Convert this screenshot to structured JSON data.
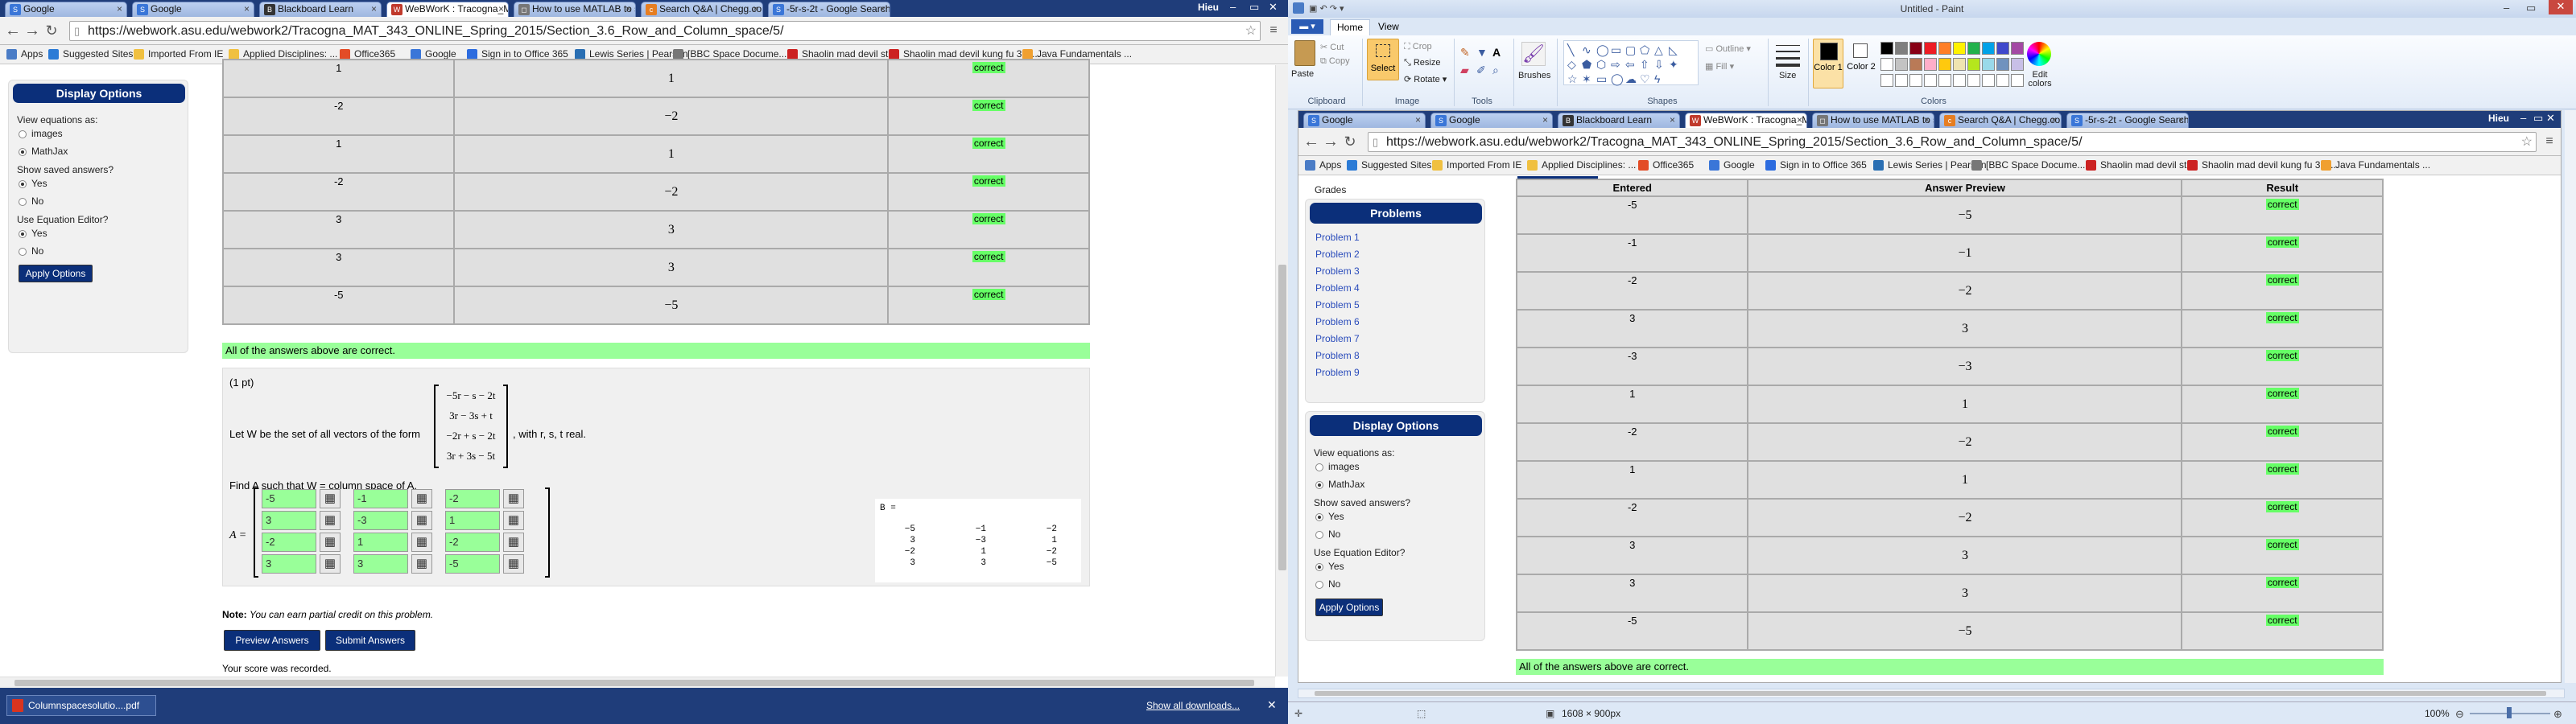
{
  "left": {
    "tabs": [
      {
        "label": "Google",
        "color": "#3a76d8",
        "glyph": "S"
      },
      {
        "label": "Google",
        "color": "#3a76d8",
        "glyph": "S"
      },
      {
        "label": "Blackboard Learn",
        "color": "#333333",
        "glyph": "B"
      },
      {
        "label": "WeBWorK : Tracogna_MA",
        "color": "#c0392b",
        "glyph": "W"
      },
      {
        "label": "How to use MATLAB to s",
        "color": "#777777",
        "glyph": "◻"
      },
      {
        "label": "Search Q&A | Chegg.com",
        "color": "#e67e22",
        "glyph": "c"
      },
      {
        "label": "-5r-s-2t - Google Search",
        "color": "#3a76d8",
        "glyph": "S"
      }
    ],
    "user": "Hieu",
    "url": "https://webwork.asu.edu/webwork2/Tracogna_MAT_343_ONLINE_Spring_2015/Section_3.6_Row_and_Column_space/5/",
    "bookmarks": [
      "Apps",
      "Suggested Sites",
      "Imported From IE",
      "Applied Disciplines: ...",
      "Office365",
      "Google",
      "Sign in to Office 365",
      "Lewis Series | Pearson",
      "[BBC Space Docume...",
      "Shaolin mad devil st...",
      "Shaolin mad devil kung fu 32 j...",
      "Java Fundamentals ..."
    ],
    "display_options": {
      "title": "Display Options",
      "view_label": "View equations as:",
      "view_options": [
        "images",
        "MathJax"
      ],
      "saved_label": "Show saved answers?",
      "saved_options": [
        "Yes",
        "No"
      ],
      "editor_label": "Use Equation Editor?",
      "editor_options": [
        "Yes",
        "No"
      ],
      "apply": "Apply Options"
    },
    "results_rows": [
      {
        "entered": "1",
        "preview": "1",
        "result": "correct"
      },
      {
        "entered": "-2",
        "preview": "−2",
        "result": "correct"
      },
      {
        "entered": "1",
        "preview": "1",
        "result": "correct"
      },
      {
        "entered": "-2",
        "preview": "−2",
        "result": "correct"
      },
      {
        "entered": "3",
        "preview": "3",
        "result": "correct"
      },
      {
        "entered": "3",
        "preview": "3",
        "result": "correct"
      },
      {
        "entered": "-5",
        "preview": "−5",
        "result": "correct"
      }
    ],
    "all_correct": "All of the answers above are correct.",
    "problem": {
      "points": "(1 pt)",
      "let_text": "Let W be the set of all vectors of the form",
      "vector": [
        "−5r − s − 2t",
        "3r − 3s + t",
        "−2r + s − 2t",
        "3r + 3s − 5t"
      ],
      "with_text": ", with r, s, t real.",
      "find_text": "Find A such that W = column space of A.",
      "a_label": "A =",
      "matrix": [
        [
          "-5",
          "-1",
          "-2"
        ],
        [
          "3",
          "-3",
          "1"
        ],
        [
          "-2",
          "1",
          "-2"
        ],
        [
          "3",
          "3",
          "-5"
        ]
      ],
      "side_label": "B =",
      "side_matrix": [
        [
          "−5",
          "−1",
          "−2"
        ],
        [
          "3",
          "−3",
          "1"
        ],
        [
          "−2",
          "1",
          "−2"
        ],
        [
          "3",
          "3",
          "−5"
        ]
      ]
    },
    "note_label": "Note:",
    "note_text": "You can earn partial credit on this problem.",
    "preview_btn": "Preview Answers",
    "submit_btn": "Submit Answers",
    "score_text": "Your score was recorded.",
    "download_file": "Columnspacesolutio....pdf",
    "show_downloads": "Show all downloads..."
  },
  "paint": {
    "title": "Untitled - Paint",
    "menu_tabs": [
      "Home",
      "View"
    ],
    "clipboard": {
      "paste": "Paste",
      "cut": "Cut",
      "copy": "Copy",
      "label": "Clipboard"
    },
    "image": {
      "select": "Select",
      "crop": "Crop",
      "resize": "Resize",
      "rotate": "Rotate",
      "label": "Image"
    },
    "tools_label": "Tools",
    "brushes": "Brushes",
    "shapes_label": "Shapes",
    "outline": "Outline",
    "fill": "Fill",
    "size": "Size",
    "color1": "Color 1",
    "color2": "Color 2",
    "colors_label": "Colors",
    "edit_colors": "Edit colors",
    "palette": [
      "#000000",
      "#7f7f7f",
      "#880015",
      "#ed1c24",
      "#ff7f27",
      "#fff200",
      "#22b14c",
      "#00a2e8",
      "#3f48cc",
      "#a349a4",
      "#ffffff",
      "#c3c3c3",
      "#b97a57",
      "#ffaec9",
      "#ffc90e",
      "#efe4b0",
      "#b5e61d",
      "#99d9ea",
      "#7092be",
      "#c8bfe7"
    ],
    "status_size": "1608 × 900px",
    "zoom": "100%",
    "inner_tabs": [
      {
        "label": "Google",
        "color": "#3a76d8",
        "glyph": "S"
      },
      {
        "label": "Google",
        "color": "#3a76d8",
        "glyph": "S"
      },
      {
        "label": "Blackboard Learn",
        "color": "#333333",
        "glyph": "B"
      },
      {
        "label": "WeBWorK : Tracogna_MA",
        "color": "#c0392b",
        "glyph": "W"
      },
      {
        "label": "How to use MATLAB to s",
        "color": "#777777",
        "glyph": "◻"
      },
      {
        "label": "Search Q&A | Chegg.com",
        "color": "#e67e22",
        "glyph": "c"
      },
      {
        "label": "-5r-s-2t - Google Search",
        "color": "#3a76d8",
        "glyph": "S"
      }
    ],
    "inner_user": "Hieu",
    "inner_url": "https://webwork.asu.edu/webwork2/Tracogna_MAT_343_ONLINE_Spring_2015/Section_3.6_Row_and_Column_space/5/",
    "grades": "Grades",
    "problems_title": "Problems",
    "problems": [
      "Problem 1",
      "Problem 2",
      "Problem 3",
      "Problem 4",
      "Problem 5",
      "Problem 6",
      "Problem 7",
      "Problem 8",
      "Problem 9"
    ],
    "headers": [
      "Entered",
      "Answer Preview",
      "Result"
    ],
    "rows": [
      {
        "entered": "-5",
        "preview": "−5",
        "result": "correct"
      },
      {
        "entered": "-1",
        "preview": "−1",
        "result": "correct"
      },
      {
        "entered": "-2",
        "preview": "−2",
        "result": "correct"
      },
      {
        "entered": "3",
        "preview": "3",
        "result": "correct"
      },
      {
        "entered": "-3",
        "preview": "−3",
        "result": "correct"
      },
      {
        "entered": "1",
        "preview": "1",
        "result": "correct"
      },
      {
        "entered": "-2",
        "preview": "−2",
        "result": "correct"
      },
      {
        "entered": "1",
        "preview": "1",
        "result": "correct"
      },
      {
        "entered": "-2",
        "preview": "−2",
        "result": "correct"
      },
      {
        "entered": "3",
        "preview": "3",
        "result": "correct"
      },
      {
        "entered": "3",
        "preview": "3",
        "result": "correct"
      },
      {
        "entered": "-5",
        "preview": "−5",
        "result": "correct"
      }
    ],
    "all_correct": "All of the answers above are correct."
  }
}
